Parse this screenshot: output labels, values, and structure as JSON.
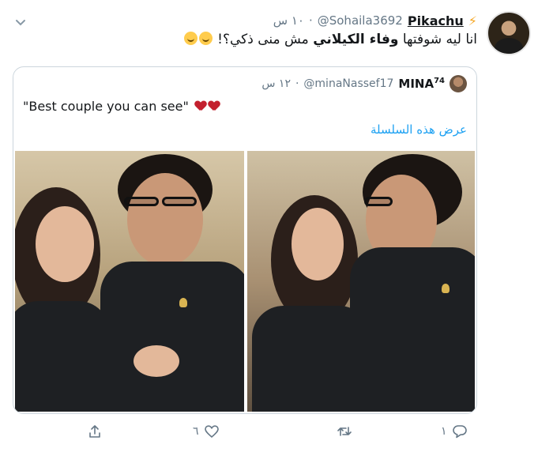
{
  "tweet": {
    "display_name": "Pikachu",
    "handle": "@Sohaila3692",
    "time": "١٠ س",
    "text_prefix": "انا ليه شوفتها ",
    "text_bold": "وفاء الكيلاني",
    "text_suffix": " مش منى ذكي؟!"
  },
  "quoted": {
    "display_name": "MINA",
    "superscript": "74",
    "handle": "@minaNassef17",
    "time": "١٢ س",
    "text": "\"Best couple you can see\"",
    "thread_link": "عرض هذه السلسلة"
  },
  "actions": {
    "reply_count": "١",
    "like_count": "٦"
  },
  "colors": {
    "link": "#1da1f2",
    "secondary": "#657786",
    "heart": "#c3202e",
    "bolt": "#f5a623"
  },
  "icons": [
    "chevron-down-icon",
    "lightning-icon",
    "reply-icon",
    "retweet-icon",
    "like-icon",
    "share-icon",
    "heart-emoji-icon",
    "sweat-smile-emoji-icon",
    "eye-roll-emoji-icon"
  ]
}
